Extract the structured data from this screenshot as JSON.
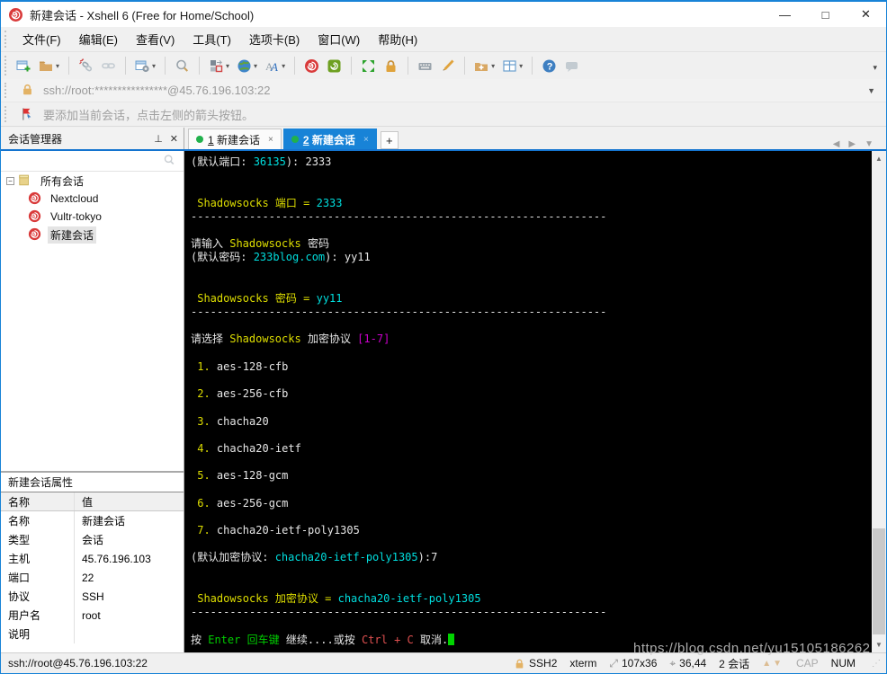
{
  "window": {
    "title": "新建会话 - Xshell 6 (Free for Home/School)"
  },
  "menu": {
    "items": [
      "文件(F)",
      "编辑(E)",
      "查看(V)",
      "工具(T)",
      "选项卡(B)",
      "窗口(W)",
      "帮助(H)"
    ]
  },
  "toolbar": {
    "icons": [
      "new-session",
      "open-session-folder",
      "disconnect",
      "reconnect",
      "session-properties",
      "find",
      "transfer-layout",
      "encoding-globe",
      "fonts",
      "xshell-app",
      "xftp-app",
      "fullscreen",
      "lock-screen",
      "virtual-keyboard",
      "highlight-pen",
      "new-session-folder",
      "tile-windows",
      "help",
      "feedback"
    ]
  },
  "address_bar": {
    "value": "ssh://root:****************@45.76.196.103:22"
  },
  "info_bar": {
    "text": "要添加当前会话，点击左侧的箭头按钮。"
  },
  "session_manager": {
    "title": "会话管理器",
    "search_value": "",
    "tree": {
      "root": "所有会话",
      "sessions": [
        "Nextcloud",
        "Vultr-tokyo",
        "新建会话"
      ],
      "selected": "新建会话"
    }
  },
  "properties": {
    "title": "新建会话属性",
    "columns": [
      "名称",
      "值"
    ],
    "rows": [
      [
        "名称",
        "新建会话"
      ],
      [
        "类型",
        "会话"
      ],
      [
        "主机",
        "45.76.196.103"
      ],
      [
        "端口",
        "22"
      ],
      [
        "协议",
        "SSH"
      ],
      [
        "用户名",
        "root"
      ],
      [
        "说明",
        ""
      ]
    ]
  },
  "tabs": {
    "items": [
      {
        "num": "1",
        "label": "新建会话",
        "close": "×",
        "active": false
      },
      {
        "num": "2",
        "label": "新建会话",
        "close": "×",
        "active": true
      }
    ],
    "new_tab": "+"
  },
  "terminal": {
    "colors": {
      "background": "#000000",
      "white": "#e6e6e6",
      "yellow": "#dede00",
      "cyan": "#00dede",
      "magenta": "#cd00cd",
      "green": "#00cd00",
      "red": "#e05050"
    },
    "lines": [
      [
        {
          "t": "(默认端口: ",
          "c": "w"
        },
        {
          "t": "36135",
          "c": "c"
        },
        {
          "t": "): 2333",
          "c": "w"
        }
      ],
      [],
      [],
      [
        {
          "t": " Shadowsocks 端口 = ",
          "c": "y"
        },
        {
          "t": "2333",
          "c": "c"
        }
      ],
      [
        {
          "t": "----------------------------------------------------------------",
          "c": "w"
        }
      ],
      [],
      [
        {
          "t": "请输入 ",
          "c": "w"
        },
        {
          "t": "Shadowsocks",
          "c": "y"
        },
        {
          "t": " 密码",
          "c": "w"
        }
      ],
      [
        {
          "t": "(默认密码: ",
          "c": "w"
        },
        {
          "t": "233blog.com",
          "c": "c"
        },
        {
          "t": "): yy11",
          "c": "w"
        }
      ],
      [],
      [],
      [
        {
          "t": " Shadowsocks 密码 = ",
          "c": "y"
        },
        {
          "t": "yy11",
          "c": "c"
        }
      ],
      [
        {
          "t": "----------------------------------------------------------------",
          "c": "w"
        }
      ],
      [],
      [
        {
          "t": "请选择 ",
          "c": "w"
        },
        {
          "t": "Shadowsocks",
          "c": "y"
        },
        {
          "t": " 加密协议 ",
          "c": "w"
        },
        {
          "t": "[1-7]",
          "c": "m"
        }
      ],
      [],
      [
        {
          "t": " ",
          "c": "w"
        },
        {
          "t": "1.",
          "c": "y"
        },
        {
          "t": " aes-128-cfb",
          "c": "w"
        }
      ],
      [],
      [
        {
          "t": " ",
          "c": "w"
        },
        {
          "t": "2.",
          "c": "y"
        },
        {
          "t": " aes-256-cfb",
          "c": "w"
        }
      ],
      [],
      [
        {
          "t": " ",
          "c": "w"
        },
        {
          "t": "3.",
          "c": "y"
        },
        {
          "t": " chacha20",
          "c": "w"
        }
      ],
      [],
      [
        {
          "t": " ",
          "c": "w"
        },
        {
          "t": "4.",
          "c": "y"
        },
        {
          "t": " chacha20-ietf",
          "c": "w"
        }
      ],
      [],
      [
        {
          "t": " ",
          "c": "w"
        },
        {
          "t": "5.",
          "c": "y"
        },
        {
          "t": " aes-128-gcm",
          "c": "w"
        }
      ],
      [],
      [
        {
          "t": " ",
          "c": "w"
        },
        {
          "t": "6.",
          "c": "y"
        },
        {
          "t": " aes-256-gcm",
          "c": "w"
        }
      ],
      [],
      [
        {
          "t": " ",
          "c": "w"
        },
        {
          "t": "7.",
          "c": "y"
        },
        {
          "t": " chacha20-ietf-poly1305",
          "c": "w"
        }
      ],
      [],
      [
        {
          "t": "(默认加密协议: ",
          "c": "w"
        },
        {
          "t": "chacha20-ietf-poly1305",
          "c": "c"
        },
        {
          "t": "):7",
          "c": "w"
        }
      ],
      [],
      [],
      [
        {
          "t": " Shadowsocks 加密协议 = ",
          "c": "y"
        },
        {
          "t": "chacha20-ietf-poly1305",
          "c": "c"
        }
      ],
      [
        {
          "t": "----------------------------------------------------------------",
          "c": "w"
        }
      ],
      [],
      [
        {
          "t": "按 ",
          "c": "w"
        },
        {
          "t": "Enter 回车键",
          "c": "g"
        },
        {
          "t": " 继续....或按 ",
          "c": "w"
        },
        {
          "t": "Ctrl + C",
          "c": "r"
        },
        {
          "t": " 取消.",
          "c": "w"
        },
        {
          "t": " ",
          "c": "g",
          "cursor": true
        }
      ]
    ]
  },
  "status_bar": {
    "left": "ssh://root@45.76.196.103:22",
    "protocol": "SSH2",
    "term_type": "xterm",
    "size": "107x36",
    "cursor_pos": "36,44",
    "sessions": "2 会话",
    "cap": "CAP",
    "num": "NUM"
  },
  "watermark": "https://blog.csdn.net/yu15105186262",
  "accent_colors": {
    "window_blue": "#1883d7",
    "tab_active": "#1883d7",
    "logo_red": "#d93a3a",
    "xftp_green": "#6ea021"
  }
}
